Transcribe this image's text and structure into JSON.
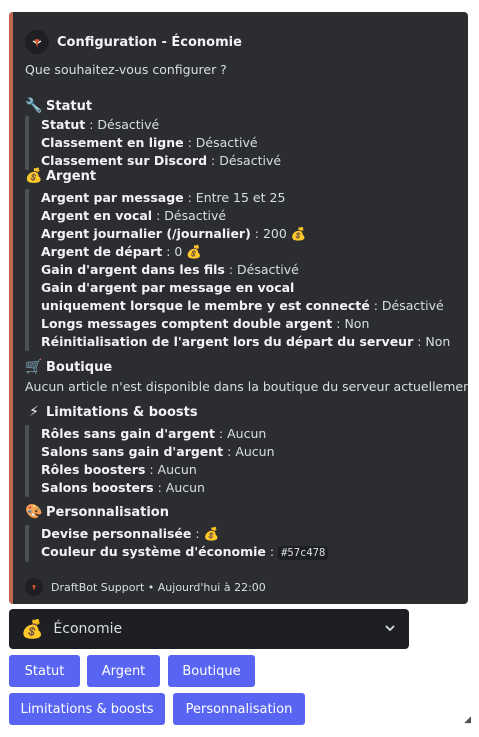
{
  "colors": {
    "accent": "#c0674b",
    "button": "#5865f2"
  },
  "embed": {
    "author_icon": "mask-logo-icon",
    "title": "Configuration - Économie",
    "description": "Que souhaitez-vous configurer ?",
    "sections": {
      "statut": {
        "emoji": "🔧",
        "title": "Statut",
        "lines": [
          {
            "label": "Statut",
            "value": " : Désactivé"
          },
          {
            "label": "Classement en ligne",
            "value": " : Désactivé"
          },
          {
            "label": "Classement sur Discord",
            "value": " : Désactivé"
          }
        ]
      },
      "argent": {
        "emoji": "💰",
        "title": "Argent",
        "lines": [
          {
            "label": "Argent par message",
            "value": " : Entre 15 et 25"
          },
          {
            "label": "Argent en vocal",
            "value": " : Désactivé"
          },
          {
            "label": "Argent journalier (/journalier)",
            "value": " : 200 💰"
          },
          {
            "label": "Argent de départ",
            "value": " : 0 💰"
          },
          {
            "label": "Gain d'argent dans les fils",
            "value": " : Désactivé"
          },
          {
            "label": "Gain d'argent par message en vocal",
            "value": ""
          },
          {
            "label": "uniquement lorsque le membre y est connecté",
            "value": " : Désactivé"
          },
          {
            "label": "Longs messages comptent double argent",
            "value": " : Non"
          },
          {
            "label": "Réinitialisation de l'argent lors du départ du serveur",
            "value": " : Non"
          }
        ]
      },
      "boutique": {
        "emoji": "🛒",
        "title": "Boutique",
        "text": "Aucun article n'est disponible dans la boutique du serveur actuellement."
      },
      "limitations": {
        "emoji": "⚡",
        "title": "Limitations & boosts",
        "lines": [
          {
            "label": "Rôles sans gain d'argent",
            "value": " : Aucun"
          },
          {
            "label": "Salons sans gain d'argent",
            "value": " : Aucun"
          },
          {
            "label": "Rôles boosters",
            "value": " : Aucun"
          },
          {
            "label": "Salons boosters",
            "value": " : Aucun"
          }
        ]
      },
      "perso": {
        "emoji": "🎨",
        "title": "Personnalisation",
        "devise_label": "Devise personnalisée",
        "devise_value": " : 💰",
        "couleur_label": "Couleur du système d'économie",
        "couleur_sep": " : ",
        "couleur_value": "#57c478"
      }
    },
    "footer": "DraftBot Support • Aujourd'hui à 22:00"
  },
  "select": {
    "emoji": "💰",
    "label": "Économie",
    "icon": "chevron-down-icon"
  },
  "buttons": {
    "statut": "Statut",
    "argent": "Argent",
    "boutique": "Boutique",
    "limitations": "Limitations & boosts",
    "personnalisation": "Personnalisation"
  }
}
